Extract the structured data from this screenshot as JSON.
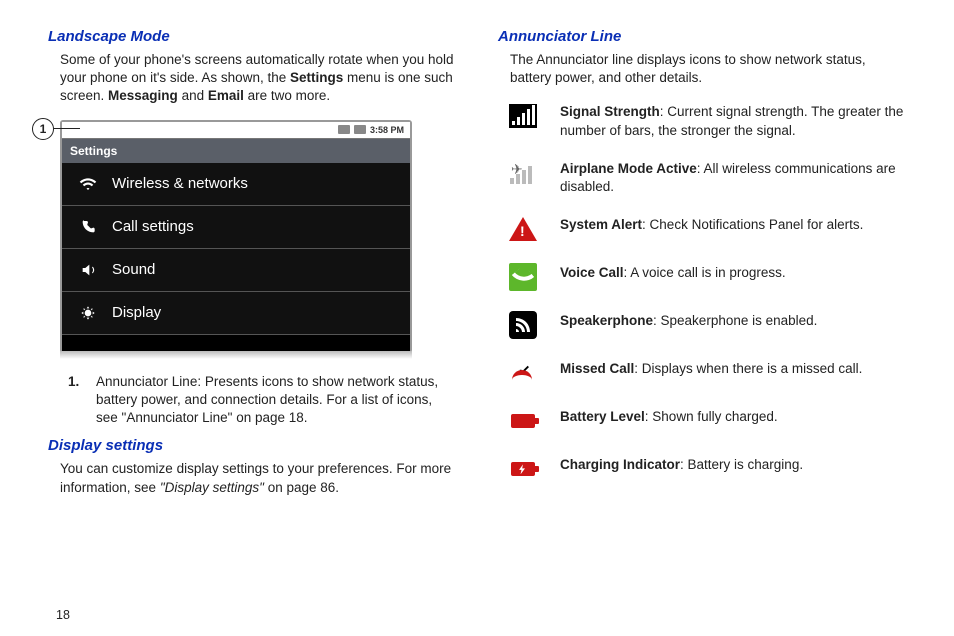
{
  "left": {
    "heading1": "Landscape Mode",
    "para1_a": "Some of your phone's screens automatically rotate when you hold your phone on it's side. As shown, the ",
    "para1_b": "Settings",
    "para1_c": " menu is one such screen. ",
    "para1_d": "Messaging",
    "para1_e": " and ",
    "para1_f": "Email",
    "para1_g": " are two more.",
    "callout_num": "1",
    "phone": {
      "time": "3:58 PM",
      "title": "Settings",
      "rows": [
        {
          "label": "Wireless & networks"
        },
        {
          "label": "Call settings"
        },
        {
          "label": "Sound"
        },
        {
          "label": "Display"
        }
      ]
    },
    "list1_num": "1.",
    "list1_bold": "Annunciator Line",
    "list1_a": ": Presents icons to show network status, battery power, and connection details. For a list of icons, see ",
    "list1_ital": "\"Annunciator Line\"",
    "list1_b": " on page 18.",
    "heading2": "Display settings",
    "para2_a": "You can customize display settings to your preferences. For more information, see ",
    "para2_ital": "\"Display settings\"",
    "para2_b": " on page 86."
  },
  "right": {
    "heading": "Annunciator Line",
    "intro": "The Annunciator line displays icons to show network status, battery power, and other details.",
    "items": [
      {
        "name": "Signal Strength",
        "desc": ": Current signal strength. The greater the number of bars, the stronger the signal."
      },
      {
        "name": "Airplane Mode Active",
        "desc": ": All wireless communications are disabled."
      },
      {
        "name": "System Alert",
        "desc": ": Check Notifications Panel for alerts."
      },
      {
        "name": "Voice Call",
        "desc": ": A voice call is in progress."
      },
      {
        "name": "Speakerphone",
        "desc": ": Speakerphone is enabled."
      },
      {
        "name": "Missed Call",
        "desc": ": Displays when there is a missed call."
      },
      {
        "name": "Battery Level",
        "desc": ": Shown fully charged."
      },
      {
        "name": "Charging Indicator",
        "desc": ": Battery is charging."
      }
    ]
  },
  "page_number": "18"
}
